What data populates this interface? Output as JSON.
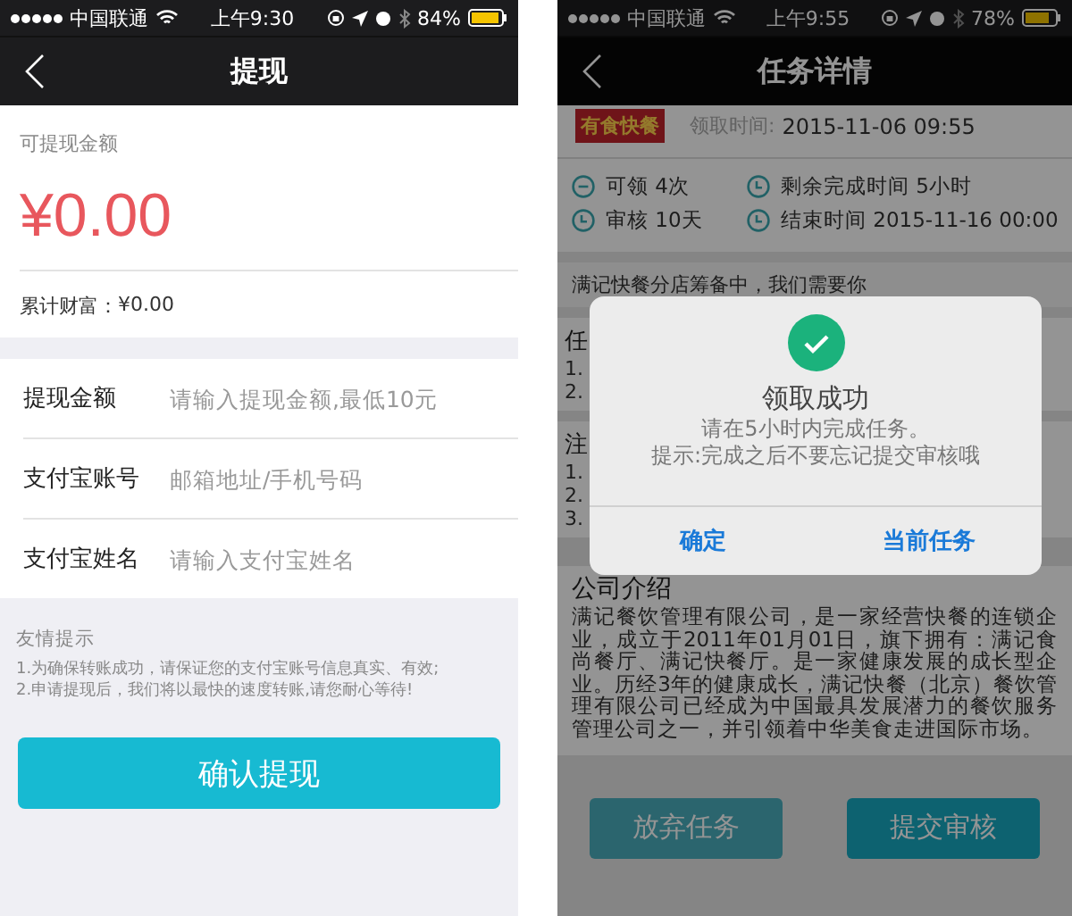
{
  "withdraw_screen": {
    "status_bar": {
      "carrier": "中国联通",
      "time": "上午9:30",
      "battery": "84%"
    },
    "nav": {
      "title": "提现"
    },
    "balance": {
      "label": "可提现金额",
      "amount": "¥0.00"
    },
    "total": {
      "label": "累计财富：",
      "value": "¥0.00"
    },
    "form": [
      {
        "label": "提现金额",
        "placeholder": "请输入提现金额,最低10元"
      },
      {
        "label": "支付宝账号",
        "placeholder": "邮箱地址/手机号码"
      },
      {
        "label": "支付宝姓名",
        "placeholder": "请输入支付宝姓名"
      }
    ],
    "tips": {
      "title": "友情提示",
      "lines": [
        "1.为确保转账成功，请保证您的支付宝账号信息真实、有效;",
        "2.申请提现后，我们将以最快的速度转账,请您耐心等待!"
      ]
    },
    "submit_button": "确认提现"
  },
  "task_screen": {
    "status_bar": {
      "carrier": "中国联通",
      "time": "上午9:55",
      "battery": "78%"
    },
    "nav": {
      "title": "任务详情"
    },
    "logo": "有食快餐",
    "claim_time": {
      "label": "领取时间:",
      "value": "2015-11-06 09:55"
    },
    "info": [
      {
        "kind": "count",
        "text": "可领 4次"
      },
      {
        "kind": "clock",
        "text": "剩余完成时间  5小时"
      },
      {
        "kind": "clock",
        "text": "审核 10天"
      },
      {
        "kind": "clock",
        "text": "结束时间 2015-11-16 00:00"
      }
    ],
    "headline": "满记快餐分店筹备中，我们需要你",
    "sections": [
      {
        "title": "任",
        "lines": [
          "1.",
          "2."
        ]
      },
      {
        "title": "注",
        "lines": [
          "1.",
          "2.",
          "3."
        ]
      }
    ],
    "about": {
      "title": "公司介绍",
      "body": "满记餐饮管理有限公司，是一家经营快餐的连锁企业，成立于2011年01月01日，旗下拥有：满记食尚餐厅、满记快餐厅。是一家健康发展的成长型企业。历经3年的健康成长，满记快餐（北京）餐饮管理有限公司已经成为中国最具发展潜力的餐饮服务管理公司之一，并引领着中华美食走进国际市场。"
    },
    "buttons": [
      {
        "label": "放弃任务",
        "primary": false
      },
      {
        "label": "提交审核",
        "primary": true
      }
    ],
    "dialog": {
      "title": "领取成功",
      "lines": [
        "请在5小时内完成任务。",
        "提示:完成之后不要忘记提交审核哦"
      ],
      "buttons": [
        "确定",
        "当前任务"
      ]
    }
  }
}
